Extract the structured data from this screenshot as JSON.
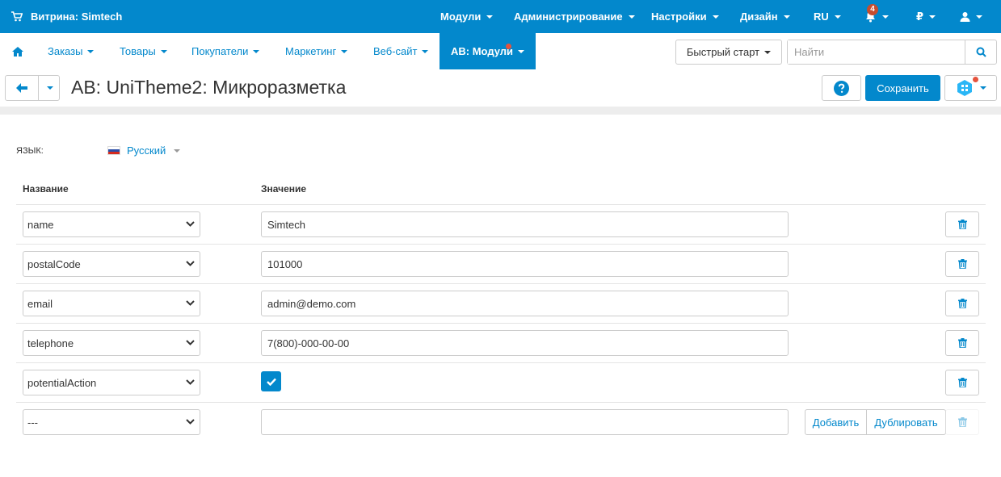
{
  "topbar": {
    "store_label": "Витрина: Simtech",
    "menus": [
      "Модули",
      "Администрирование",
      "Настройки",
      "Дизайн",
      "RU"
    ],
    "notifications_count": "4",
    "currency": "₽"
  },
  "nav": {
    "items": [
      "Заказы",
      "Товары",
      "Покупатели",
      "Маркетинг",
      "Веб-сайт",
      "AB: Модули"
    ],
    "quick_start": "Быстрый старт",
    "search_placeholder": "Найти"
  },
  "page": {
    "title": "AB: UniTheme2: Микроразметка",
    "save_label": "Сохранить"
  },
  "form": {
    "language_label": "ЯЗЫК:",
    "language_value": "Русский",
    "col_name": "Название",
    "col_value": "Значение",
    "rows": [
      {
        "name": "name",
        "value": "Simtech"
      },
      {
        "name": "postalCode",
        "value": "101000"
      },
      {
        "name": "email",
        "value": "admin@demo.com"
      },
      {
        "name": "telephone",
        "value": "7(800)-000-00-00"
      },
      {
        "name": "potentialAction",
        "value": "",
        "checked": true
      },
      {
        "name": "---",
        "value": ""
      }
    ],
    "add_label": "Добавить",
    "duplicate_label": "Дублировать"
  },
  "colors": {
    "primary": "#0388cc",
    "badge": "#c64d2e"
  }
}
